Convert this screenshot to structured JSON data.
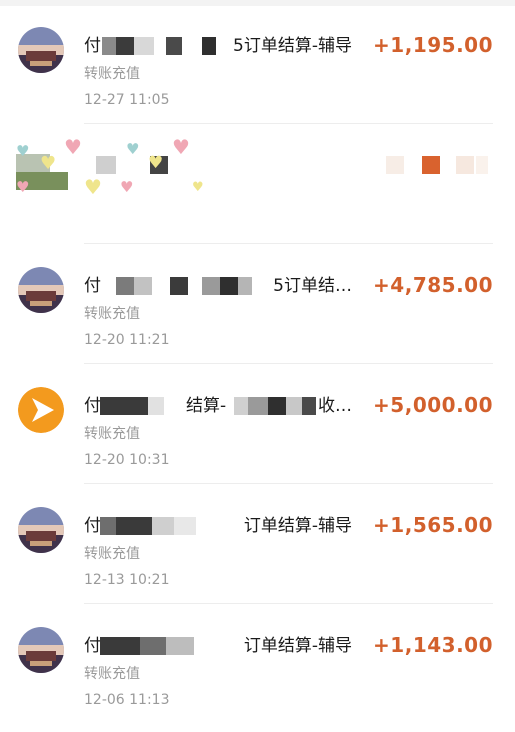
{
  "transactions": [
    {
      "title_head": "付",
      "title_tail": "5订单结算-辅导",
      "subtitle": "转账充值",
      "amount": "+1,195.00",
      "time": "12-27  11:05",
      "avatar": "photo"
    },
    {
      "title_head": "",
      "title_tail": "",
      "subtitle": "",
      "amount": "",
      "time": "",
      "avatar": "sticker"
    },
    {
      "title_head": "付",
      "title_tail": "5订单结…",
      "subtitle": "转账充值",
      "amount": "+4,785.00",
      "time": "12-20  11:21",
      "avatar": "photo"
    },
    {
      "title_head": "付",
      "title_tail": "收…",
      "mid_text": "结算-",
      "subtitle": "转账充值",
      "amount": "+5,000.00",
      "time": "12-20  10:31",
      "avatar": "play-logo"
    },
    {
      "title_head": "付",
      "title_tail": "订单结算-辅导",
      "subtitle": "转账充值",
      "amount": "+1,565.00",
      "time": "12-13  10:21",
      "avatar": "photo"
    },
    {
      "title_head": "付",
      "title_tail": "订单结算-辅导",
      "subtitle": "转账充值",
      "amount": "+1,143.00",
      "time": "12-06  11:13",
      "avatar": "photo"
    }
  ],
  "colors": {
    "amount": "#d2602c",
    "secondary_text": "#9a9a9a",
    "play_logo": "#f39a1e"
  },
  "icons": {
    "photo_avatar": "building-photo-icon",
    "play_logo": "play-triangle-icon",
    "sticker": "heart-sticker-icon"
  }
}
